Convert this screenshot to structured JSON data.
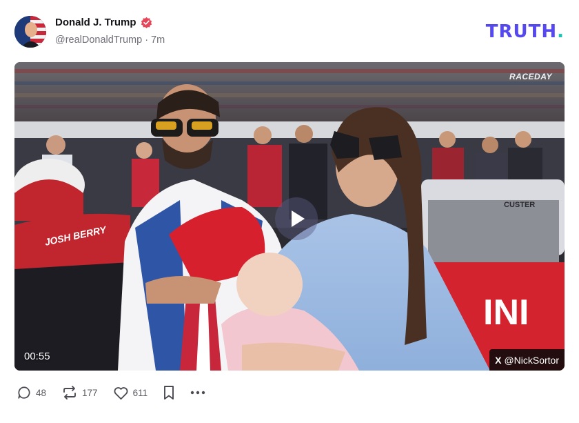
{
  "post": {
    "author_name": "Donald J. Trump",
    "handle": "@realDonaldTrump",
    "separator": "·",
    "time_ago": "7m",
    "brand_logo": "TRUTH",
    "brand_dot": "."
  },
  "video": {
    "duration": "00:55",
    "watermark_top": "RACEDAY",
    "watermark_bottom": "@NickSortor",
    "watermark_x_icon": "X",
    "car_name_text": "JOSH BERRY",
    "car_sponsor_text": "CUSTER"
  },
  "actions": {
    "replies": "48",
    "retruths": "177",
    "likes": "611"
  },
  "colors": {
    "brand": "#5448ee",
    "brand_dot": "#13c7b0",
    "verified": "#e5465a"
  },
  "icons": [
    "verified-badge-icon",
    "play-icon",
    "reply-icon",
    "retruth-icon",
    "like-icon",
    "bookmark-icon",
    "more-icon",
    "x-logo-icon"
  ]
}
